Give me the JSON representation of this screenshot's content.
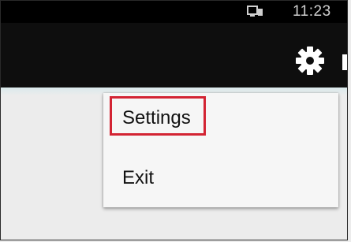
{
  "status_bar": {
    "time": "11:23",
    "icons": [
      "screen-cast-icon"
    ]
  },
  "action_bar": {
    "icons": [
      "gear-icon"
    ]
  },
  "menu": {
    "items": [
      {
        "label": "Settings",
        "highlighted": true
      },
      {
        "label": "Exit"
      }
    ]
  },
  "colors": {
    "status_bar": "#000000",
    "action_bar": "#0e0e0e",
    "menu_background": "#f6f6f6",
    "highlight_border": "#d32433"
  }
}
